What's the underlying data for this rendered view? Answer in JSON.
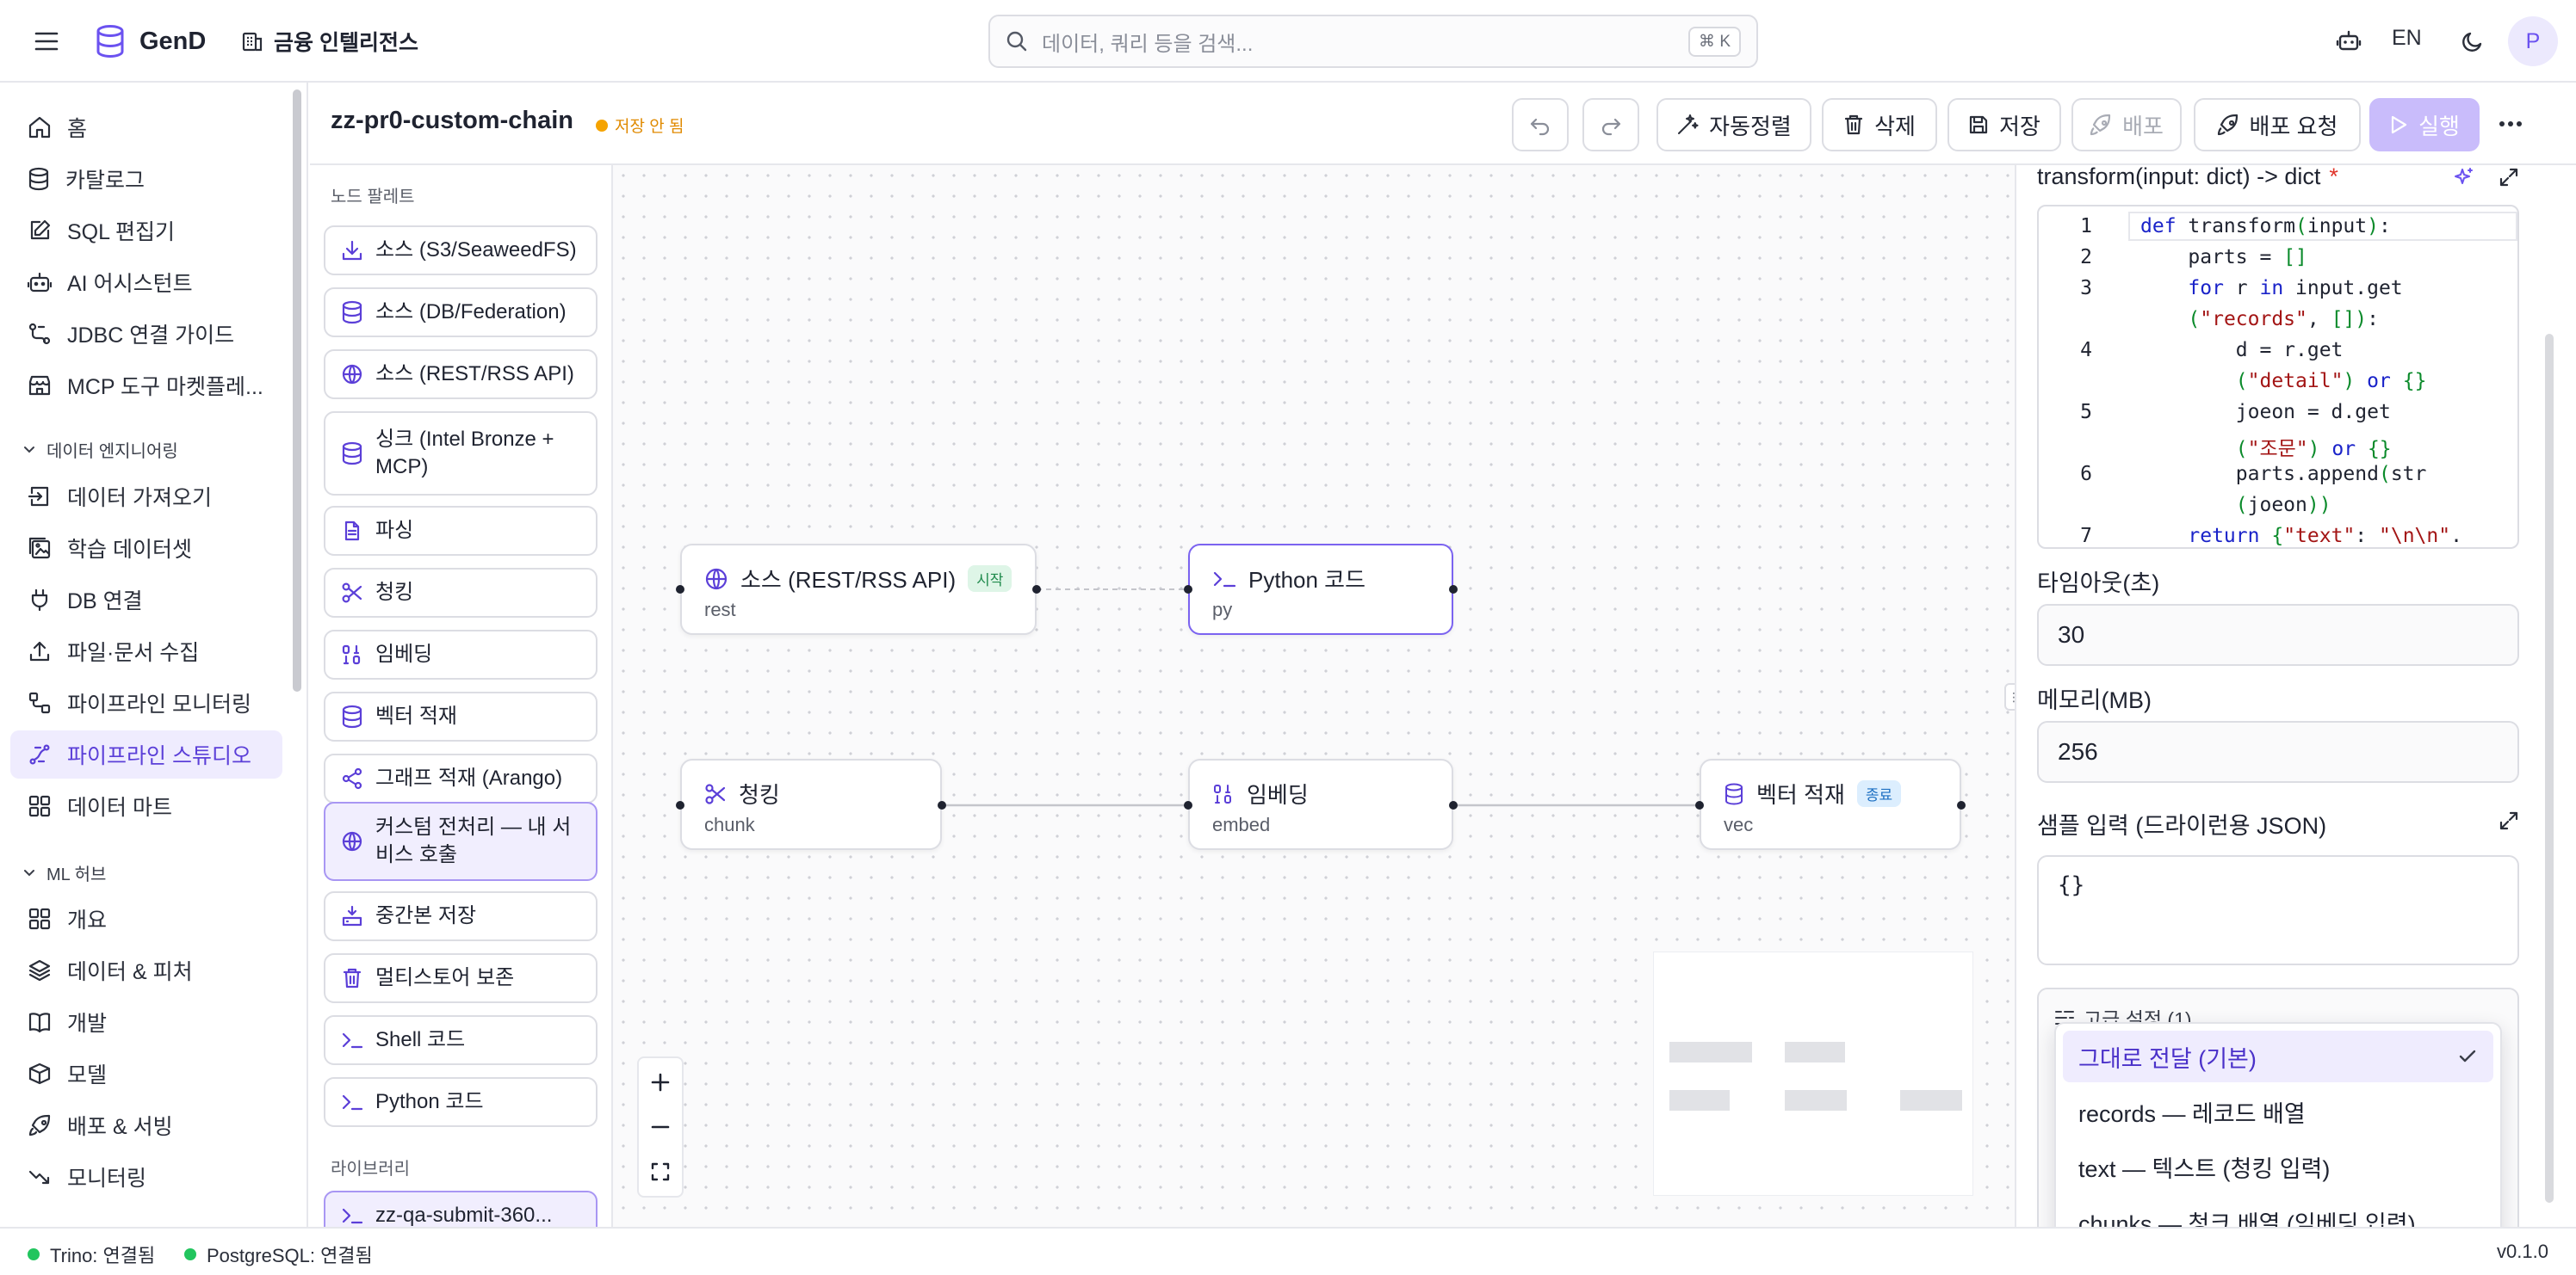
{
  "app": {
    "brand": "GenD",
    "org": "금융 인텔리전스",
    "search_placeholder": "데이터, 쿼리 등을 검색...",
    "search_shortcut": "⌘ K",
    "language": "EN",
    "avatar_initial": "P"
  },
  "sidebar": {
    "items_top": [
      {
        "label": "홈",
        "icon": "home-icon"
      },
      {
        "label": "카탈로그",
        "icon": "database-icon"
      },
      {
        "label": "SQL 편집기",
        "icon": "edit-icon"
      },
      {
        "label": "AI 어시스턴트",
        "icon": "bot-icon"
      },
      {
        "label": "JDBC 연결 가이드",
        "icon": "workflow-icon"
      },
      {
        "label": "MCP 도구 마켓플레...",
        "icon": "store-icon"
      }
    ],
    "group_data_eng": "데이터 엔지니어링",
    "items_data_eng": [
      {
        "label": "데이터 가져오기",
        "icon": "import-icon"
      },
      {
        "label": "학습 데이터셋",
        "icon": "images-icon"
      },
      {
        "label": "DB 연결",
        "icon": "plug-icon"
      },
      {
        "label": "파일·문서 수집",
        "icon": "upload-icon"
      },
      {
        "label": "파이프라인 모니터링",
        "icon": "pipeline-monitor-icon"
      },
      {
        "label": "파이프라인 스튜디오",
        "icon": "pipeline-studio-icon",
        "active": true
      },
      {
        "label": "데이터 마트",
        "icon": "grid-icon"
      }
    ],
    "group_ml": "ML 허브",
    "items_ml": [
      {
        "label": "개요",
        "icon": "grid-icon"
      },
      {
        "label": "데이터 & 피처",
        "icon": "layers-icon"
      },
      {
        "label": "개발",
        "icon": "book-icon"
      },
      {
        "label": "모델",
        "icon": "box-icon"
      },
      {
        "label": "배포 & 서빙",
        "icon": "rocket-icon"
      },
      {
        "label": "모니터링",
        "icon": "trend-icon"
      }
    ]
  },
  "pipeline": {
    "title": "zz-pr0-custom-chain",
    "status": "저장 안 됨",
    "toolbar": {
      "auto_arrange": "자동정렬",
      "delete": "삭제",
      "save": "저장",
      "deploy": "배포",
      "deploy_request": "배포 요청",
      "run": "실행"
    }
  },
  "palette": {
    "heading": "노드 팔레트",
    "items": [
      {
        "label": "소스 (S3/SeaweedFS)",
        "icon": "download-icon"
      },
      {
        "label": "소스 (DB/Federation)",
        "icon": "database-icon"
      },
      {
        "label": "소스 (REST/RSS API)",
        "icon": "globe-icon"
      },
      {
        "label": "싱크 (Intel Bronze + MCP)",
        "icon": "database-icon"
      },
      {
        "label": "파싱",
        "icon": "file-text-icon"
      },
      {
        "label": "청킹",
        "icon": "scissors-icon"
      },
      {
        "label": "임베딩",
        "icon": "binary-icon"
      },
      {
        "label": "벡터 적재",
        "icon": "database-icon"
      },
      {
        "label": "그래프 적재 (Arango)",
        "icon": "share-icon"
      },
      {
        "label": "커스텀 전처리 — 내 서비스 호출",
        "icon": "globe-icon"
      },
      {
        "label": "중간본 저장",
        "icon": "hard-drive-download-icon"
      },
      {
        "label": "멀티스토어 보존",
        "icon": "trash-icon"
      },
      {
        "label": "Shell 코드",
        "icon": "terminal-icon"
      },
      {
        "label": "Python 코드",
        "icon": "terminal-icon"
      }
    ],
    "library_heading": "라이브러리",
    "library_items": [
      {
        "label": "zz-qa-submit-360...",
        "icon": "terminal-icon"
      }
    ]
  },
  "canvas": {
    "nodes": [
      {
        "id": "n1",
        "title": "소스 (REST/RSS API)",
        "sub": "rest",
        "badge": "시작",
        "icon": "globe-icon"
      },
      {
        "id": "n2",
        "title": "Python 코드",
        "sub": "py",
        "icon": "terminal-icon",
        "selected": true
      },
      {
        "id": "n3",
        "title": "청킹",
        "sub": "chunk",
        "icon": "scissors-icon"
      },
      {
        "id": "n4",
        "title": "임베딩",
        "sub": "embed",
        "icon": "binary-icon"
      },
      {
        "id": "n5",
        "title": "벡터 적재",
        "sub": "vec",
        "badge": "종료",
        "icon": "database-icon"
      }
    ]
  },
  "properties": {
    "code_label": "transform(input: dict) -> dict",
    "required_mark": "*",
    "code_lines": [
      {
        "n": "1",
        "text": "def transform(input):"
      },
      {
        "n": "2",
        "text": "    parts = []"
      },
      {
        "n": "3",
        "text": "    for r in input.get"
      },
      {
        "n": "",
        "text": "    (\"records\", []):"
      },
      {
        "n": "4",
        "text": "        d = r.get"
      },
      {
        "n": "",
        "text": "        (\"detail\") or {}"
      },
      {
        "n": "5",
        "text": "        joeon = d.get"
      },
      {
        "n": "",
        "text": "        (\"조문\") or {}"
      },
      {
        "n": "6",
        "text": "        parts.append(str"
      },
      {
        "n": "",
        "text": "        (joeon))"
      },
      {
        "n": "7",
        "text": "    return {\"text\": \"\\n\\n\"."
      }
    ],
    "timeout_label": "타임아웃(초)",
    "timeout_value": "30",
    "memory_label": "메모리(MB)",
    "memory_value": "256",
    "sample_label": "샘플 입력 (드라이런용 JSON)",
    "sample_value": "{}",
    "advanced_label": "고급 설정 (1)"
  },
  "dropdown": {
    "options": [
      {
        "label": "그대로 전달 (기본)",
        "selected": true
      },
      {
        "label": "records — 레코드 배열"
      },
      {
        "label": "text — 텍스트 (청킹 입력)"
      },
      {
        "label": "chunks — 청크 배열 (임베딩 입력)"
      }
    ]
  },
  "statusbar": {
    "trino": "Trino: 연결됨",
    "postgres": "PostgreSQL: 연결됨",
    "version": "v0.1.0"
  },
  "colors": {
    "accent": "#6b52f0",
    "status_ok": "#22c55e",
    "unsaved": "#f5a300"
  }
}
